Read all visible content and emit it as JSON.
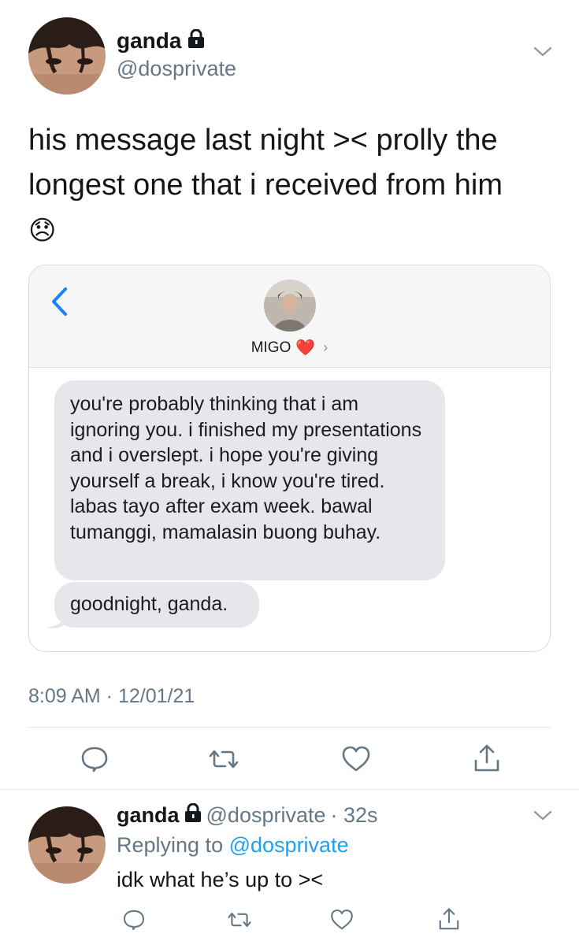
{
  "tweet": {
    "display_name": "ganda",
    "handle": "@dosprivate",
    "text": "his message last night >< prolly the longest one that i received from him",
    "emoji": "😞",
    "timestamp": "8:09 AM · 12/01/21"
  },
  "message_card": {
    "contact_name": "MIGO",
    "contact_emoji": "❤️",
    "contact_arrow": "›",
    "messages": [
      "you're probably thinking that i am ignoring you. i finished my presentations and i overslept. i hope you're giving yourself a break, i know you're tired. labas tayo after exam week. bawal tumanggi, mamalasin buong buhay.",
      "goodnight, ganda."
    ]
  },
  "reply": {
    "display_name": "ganda",
    "handle": "@dosprivate",
    "time": "· 32s",
    "replying_prefix": "Replying to",
    "replying_to": "@dosprivate",
    "text": "idk what he’s up to ><"
  },
  "icons": {
    "lock": "lock-icon",
    "chevron": "chevron-down-icon",
    "back": "chevron-left-icon",
    "reply": "reply-icon",
    "retweet": "retweet-icon",
    "like": "heart-icon",
    "share": "share-icon"
  },
  "colors": {
    "link_blue": "#1da1f2",
    "ios_blue": "#1a82fb",
    "muted_gray": "#657786",
    "bubble_gray": "#e6e6eb"
  }
}
